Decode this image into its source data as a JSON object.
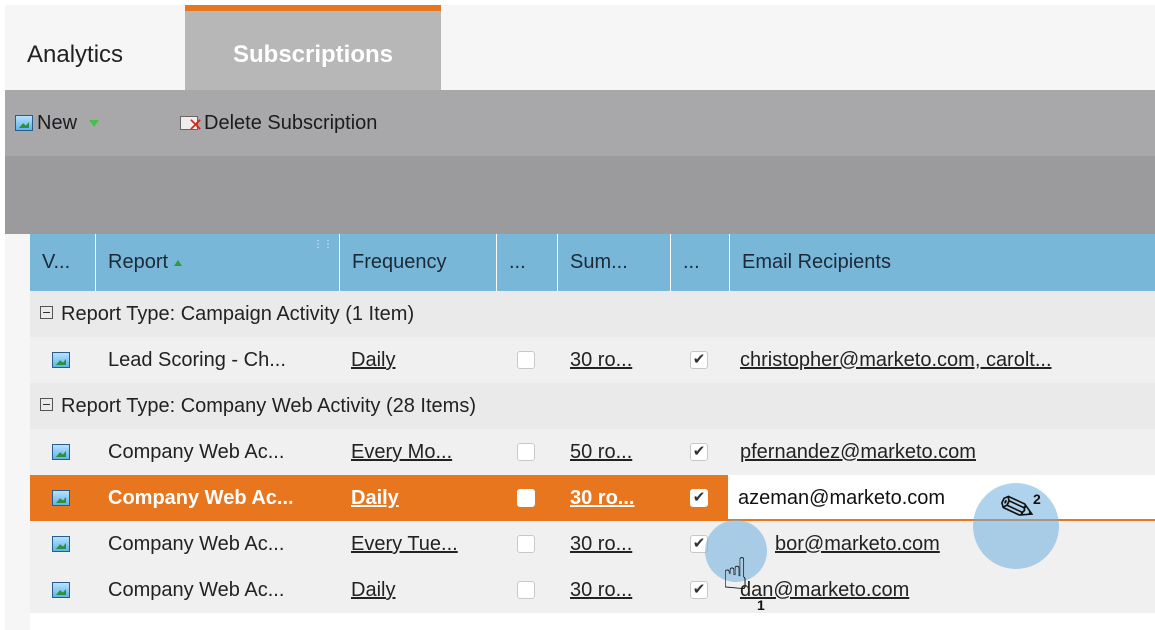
{
  "tabs": [
    {
      "label": "Analytics"
    },
    {
      "label": "Subscriptions"
    }
  ],
  "toolbar": {
    "new_label": "New",
    "delete_label": "Delete Subscription"
  },
  "columns": [
    "V...",
    "Report",
    "Frequency",
    "...",
    "Sum...",
    "...",
    "Email Recipients"
  ],
  "groups": [
    {
      "label": "Report Type: Campaign Activity (1 Item)",
      "rows": [
        {
          "report": "Lead Scoring - Ch...",
          "frequency": "Daily",
          "summary": "30 ro...",
          "checked1": false,
          "checked2": true,
          "email": "christopher@marketo.com, carolt..."
        }
      ]
    },
    {
      "label": "Report Type: Company Web Activity (28 Items)",
      "rows": [
        {
          "report": "Company Web Ac...",
          "frequency": "Every Mo...",
          "summary": "50 ro...",
          "checked1": false,
          "checked2": true,
          "email": "pfernandez@marketo.com"
        },
        {
          "report": "Company Web Ac...",
          "frequency": "Daily",
          "summary": "30 ro...",
          "checked1": false,
          "checked2": true,
          "email": "azeman@marketo.com",
          "selected": true
        },
        {
          "report": "Company Web Ac...",
          "frequency": "Every Tue...",
          "summary": "30 ro...",
          "checked1": false,
          "checked2": true,
          "email": "bor@marketo.com"
        },
        {
          "report": "Company Web Ac...",
          "frequency": "Daily",
          "summary": "30 ro...",
          "checked1": false,
          "checked2": true,
          "email": "dan@marketo.com"
        }
      ]
    }
  ],
  "callouts": {
    "step1": "1",
    "step2": "2"
  },
  "colors": {
    "accent": "#e8761f",
    "header": "#79b7d9",
    "toolbar": "#a8a8ab"
  },
  "icons": [
    "report-icon",
    "caret-down-icon",
    "delete-icon",
    "sort-asc-icon",
    "collapse-icon",
    "checkbox-icon",
    "hand-cursor-icon",
    "pencil-icon"
  ]
}
